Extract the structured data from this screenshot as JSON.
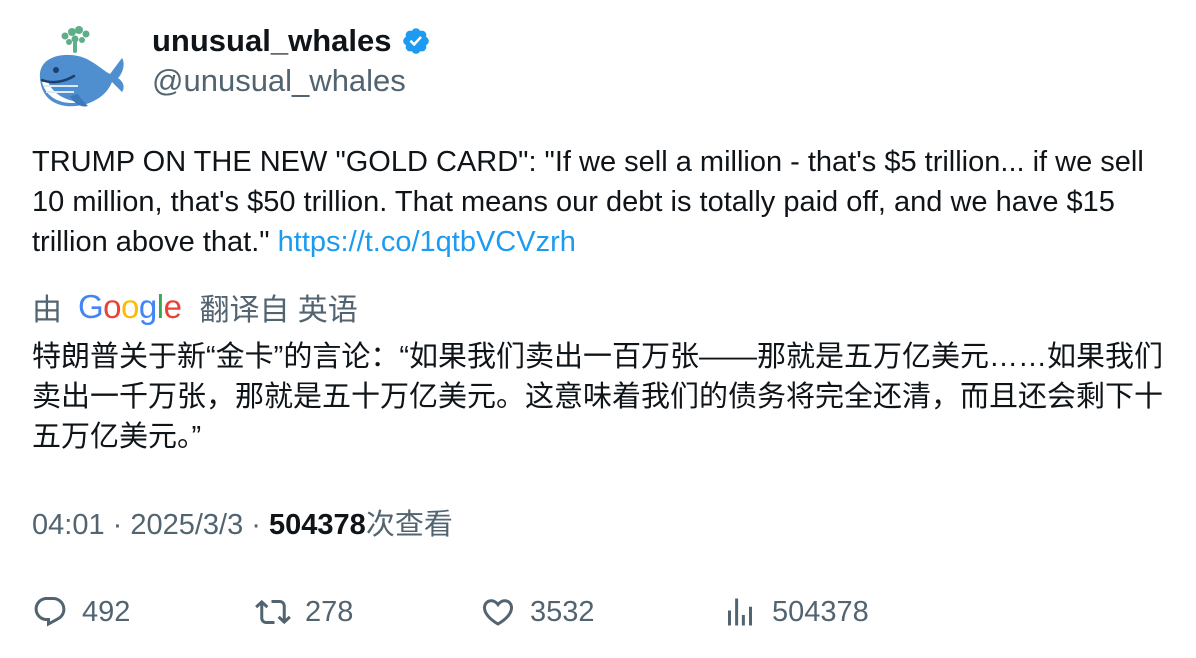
{
  "author": {
    "display_name": "unusual_whales",
    "handle": "@unusual_whales",
    "verified": true,
    "verified_color": "#1d9bf0",
    "avatar_icon": "whale-avatar-icon"
  },
  "tweet": {
    "text": "TRUMP ON THE NEW \"GOLD CARD\": \"If we sell a million - that's $5 trillion... if we sell 10 million, that's $50 trillion. That means our debt is totally paid off, and we have $15 trillion above that.\" ",
    "link": "https://t.co/1qtbVCVzrh",
    "link_color": "#1d9bf0"
  },
  "translation": {
    "by_label": "由",
    "provider": "Google",
    "provider_letters": [
      "G",
      "o",
      "o",
      "g",
      "l",
      "e"
    ],
    "provider_colors": [
      "#4285f4",
      "#ea4335",
      "#fbbc05",
      "#4285f4",
      "#34a853",
      "#ea4335"
    ],
    "from_label": "翻译自 英语",
    "text": "特朗普关于新“金卡”的言论：“如果我们卖出一百万张——那就是五万亿美元……如果我们卖出一千万张，那就是五十万亿美元。这意味着我们的债务将完全还清，而且还会剩下十五万亿美元。”"
  },
  "meta": {
    "time": "04:01",
    "separator": " · ",
    "date": "2025/3/3",
    "views_count": "504378",
    "views_label": "次查看"
  },
  "actions": {
    "reply": {
      "icon": "reply-icon",
      "count": "492"
    },
    "retweet": {
      "icon": "retweet-icon",
      "count": "278"
    },
    "like": {
      "icon": "heart-icon",
      "count": "3532"
    },
    "views": {
      "icon": "analytics-icon",
      "count": "504378"
    }
  },
  "colors": {
    "text_primary": "#0f1419",
    "text_secondary": "#536471",
    "accent": "#1d9bf0"
  }
}
